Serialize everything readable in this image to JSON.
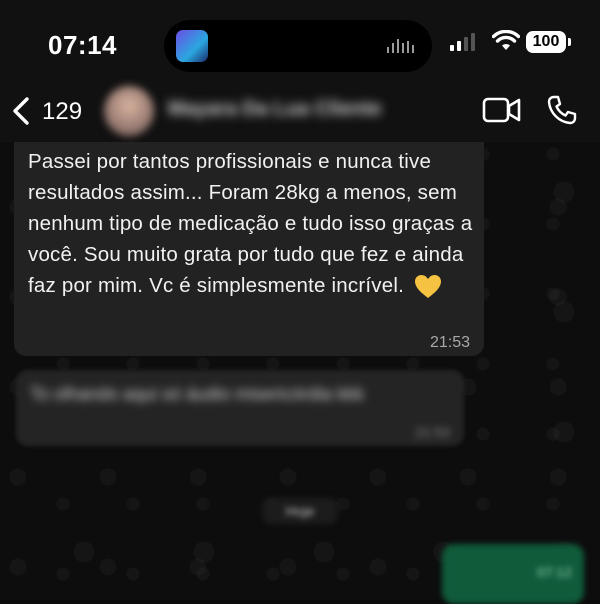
{
  "status_bar": {
    "time": "07:14",
    "battery": "100"
  },
  "header": {
    "unread_count": "129",
    "contact_name": "Mayara Da Lua Cliente"
  },
  "messages": [
    {
      "direction": "incoming",
      "text": "Passei por tantos profissionais e nunca tive resultados assim... Foram 28kg a menos, sem nenhum tipo de medicação e tudo isso graças a você. Sou muito grata por tudo que fez e ainda faz por mim. Vc é simplesmente incrível.",
      "emoji": "yellow-heart",
      "time": "21:53"
    },
    {
      "direction": "incoming",
      "blurred": true,
      "text": "To olhando aqui só áudio misericórdia kkk",
      "time": "21:53"
    }
  ],
  "date_separator": "Hoje",
  "outgoing_preview": {
    "blurred": true,
    "time": "07:12"
  },
  "icons": [
    "back-chevron-icon",
    "video-call-icon",
    "phone-call-icon",
    "signal-icon",
    "wifi-icon",
    "battery-icon"
  ],
  "colors": {
    "background": "#0d0d0d",
    "incoming_bubble": "#222222",
    "outgoing_bubble": "#0f5b3a",
    "heart": "#f5c242"
  }
}
